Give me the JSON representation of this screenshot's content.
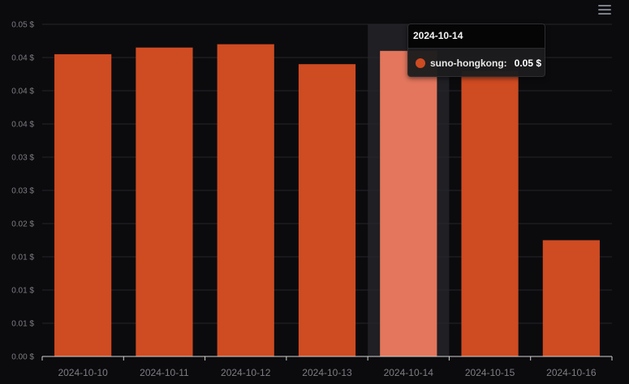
{
  "chart_data": {
    "type": "bar",
    "categories": [
      "2024-10-10",
      "2024-10-11",
      "2024-10-12",
      "2024-10-13",
      "2024-10-14",
      "2024-10-15",
      "2024-10-16"
    ],
    "series": [
      {
        "name": "suno-hongkong",
        "values": [
          0.0455,
          0.0465,
          0.047,
          0.044,
          0.046,
          0.043,
          0.0175
        ]
      }
    ],
    "ylim": [
      0,
      0.05
    ],
    "yticks": [
      0,
      0.005,
      0.01,
      0.015,
      0.02,
      0.025,
      0.03,
      0.035,
      0.04,
      0.045,
      0.05
    ],
    "ytick_labels": [
      "0.00 $",
      "0.01 $",
      "0.01 $",
      "0.01 $",
      "0.02 $",
      "0.03 $",
      "0.03 $",
      "0.04 $",
      "0.04 $",
      "0.04 $",
      "0.05 $"
    ],
    "grid": true,
    "highlight_index": 4,
    "colors": {
      "bar": "#cf4b22",
      "bar_highlight": "#e3765c",
      "grid": "#26262b",
      "axis": "#d0d0d0",
      "tick_text": "#7d7d83",
      "hover_band": "#1f1f24"
    }
  },
  "tooltip": {
    "title": "2024-10-14",
    "series_name": "suno-hongkong:",
    "value": "0.05 $"
  },
  "toolbar": {
    "menu_icon": "hamburger-menu-icon"
  }
}
